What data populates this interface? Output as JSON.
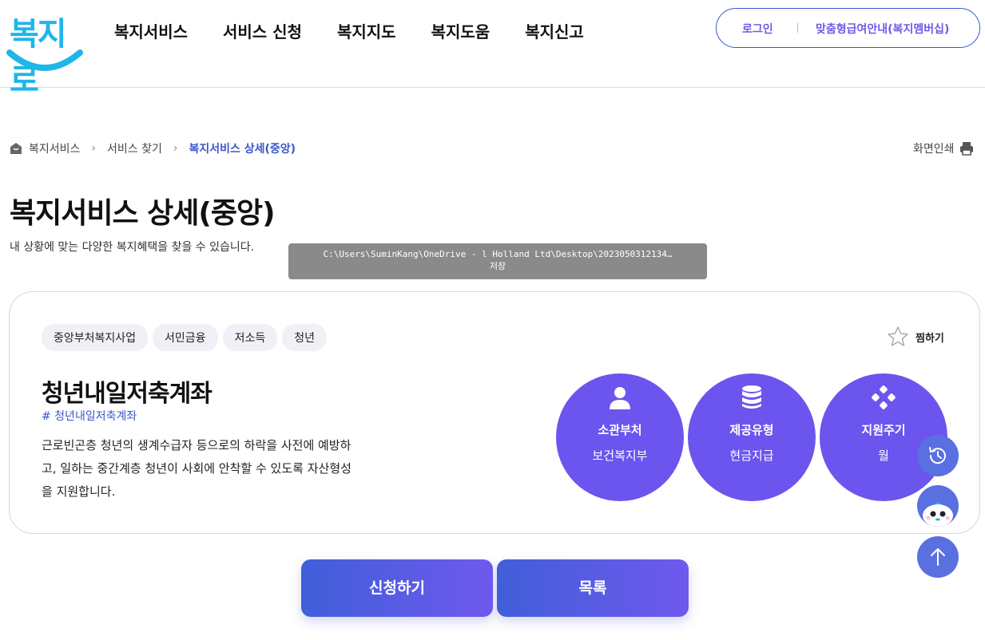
{
  "header": {
    "logo_text": "복지로",
    "nav": [
      "복지서비스",
      "서비스 신청",
      "복지지도",
      "복지도움",
      "복지신고"
    ],
    "login_label": "로그인",
    "membership_label": "맞춤형급여안내(복지멤버십)"
  },
  "breadcrumb": {
    "items": [
      "복지서비스",
      "서비스 찾기",
      "복지서비스 상세(중앙)"
    ]
  },
  "print_label": "화면인쇄",
  "page": {
    "title": "복지서비스 상세(중앙)",
    "description": "내 상황에 맞는 다양한 복지혜택을 찾을 수 있습니다."
  },
  "tooltip": {
    "path": "C:\\Users\\SuminKang\\OneDrive - l Holland Ltd\\Desktop\\2023050312134…",
    "action": "저장"
  },
  "service": {
    "tags": [
      "중앙부처복지사업",
      "서민금융",
      "저소득",
      "청년"
    ],
    "favorite_label": "찜하기",
    "title": "청년내일저축계좌",
    "hashtag": "# 청년내일저축계좌",
    "description": "근로빈곤층 청년의 생계수급자 등으로의 하락을 사전에 예방하고, 일하는 중간계층 청년이 사회에 안착할 수 있도록 자산형성을 지원합니다.",
    "info": [
      {
        "label": "소관부처",
        "value": "보건복지부",
        "icon": "person-icon"
      },
      {
        "label": "제공유형",
        "value": "현금지급",
        "icon": "coin-stack-icon"
      },
      {
        "label": "지원주기",
        "value": "월",
        "icon": "cycle-icon"
      }
    ]
  },
  "buttons": {
    "apply_label": "신청하기",
    "list_label": "목록"
  },
  "colors": {
    "brand": "#1fb6e8",
    "accent": "#6b55ee",
    "link": "#3b57c9"
  }
}
